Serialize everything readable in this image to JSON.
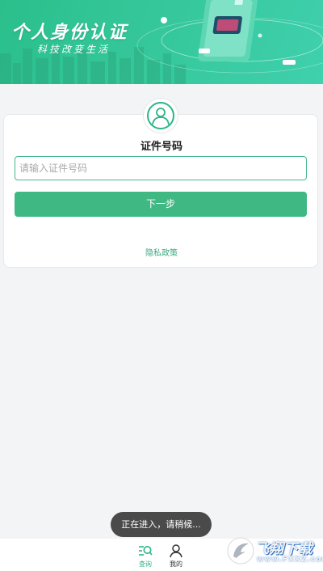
{
  "banner": {
    "title": "个人身份认证",
    "subtitle": "科技改变生活"
  },
  "form": {
    "field_title": "证件号码",
    "input_placeholder": "请输入证件号码",
    "input_value": "",
    "next_button_label": "下一步",
    "privacy_link": "隐私政策"
  },
  "toast": {
    "message": "正在进入，请稍候..."
  },
  "bottom_nav": {
    "items": [
      {
        "label": "查询",
        "icon": "search-list-icon",
        "active": true
      },
      {
        "label": "我的",
        "icon": "user-icon",
        "active": false
      }
    ]
  },
  "watermark": {
    "text": "飞翔下载",
    "url": "www.FXXZ.com"
  },
  "colors": {
    "brand": "#3fb883",
    "banner": "#35c79a",
    "page_background": "#f3f4f6"
  }
}
